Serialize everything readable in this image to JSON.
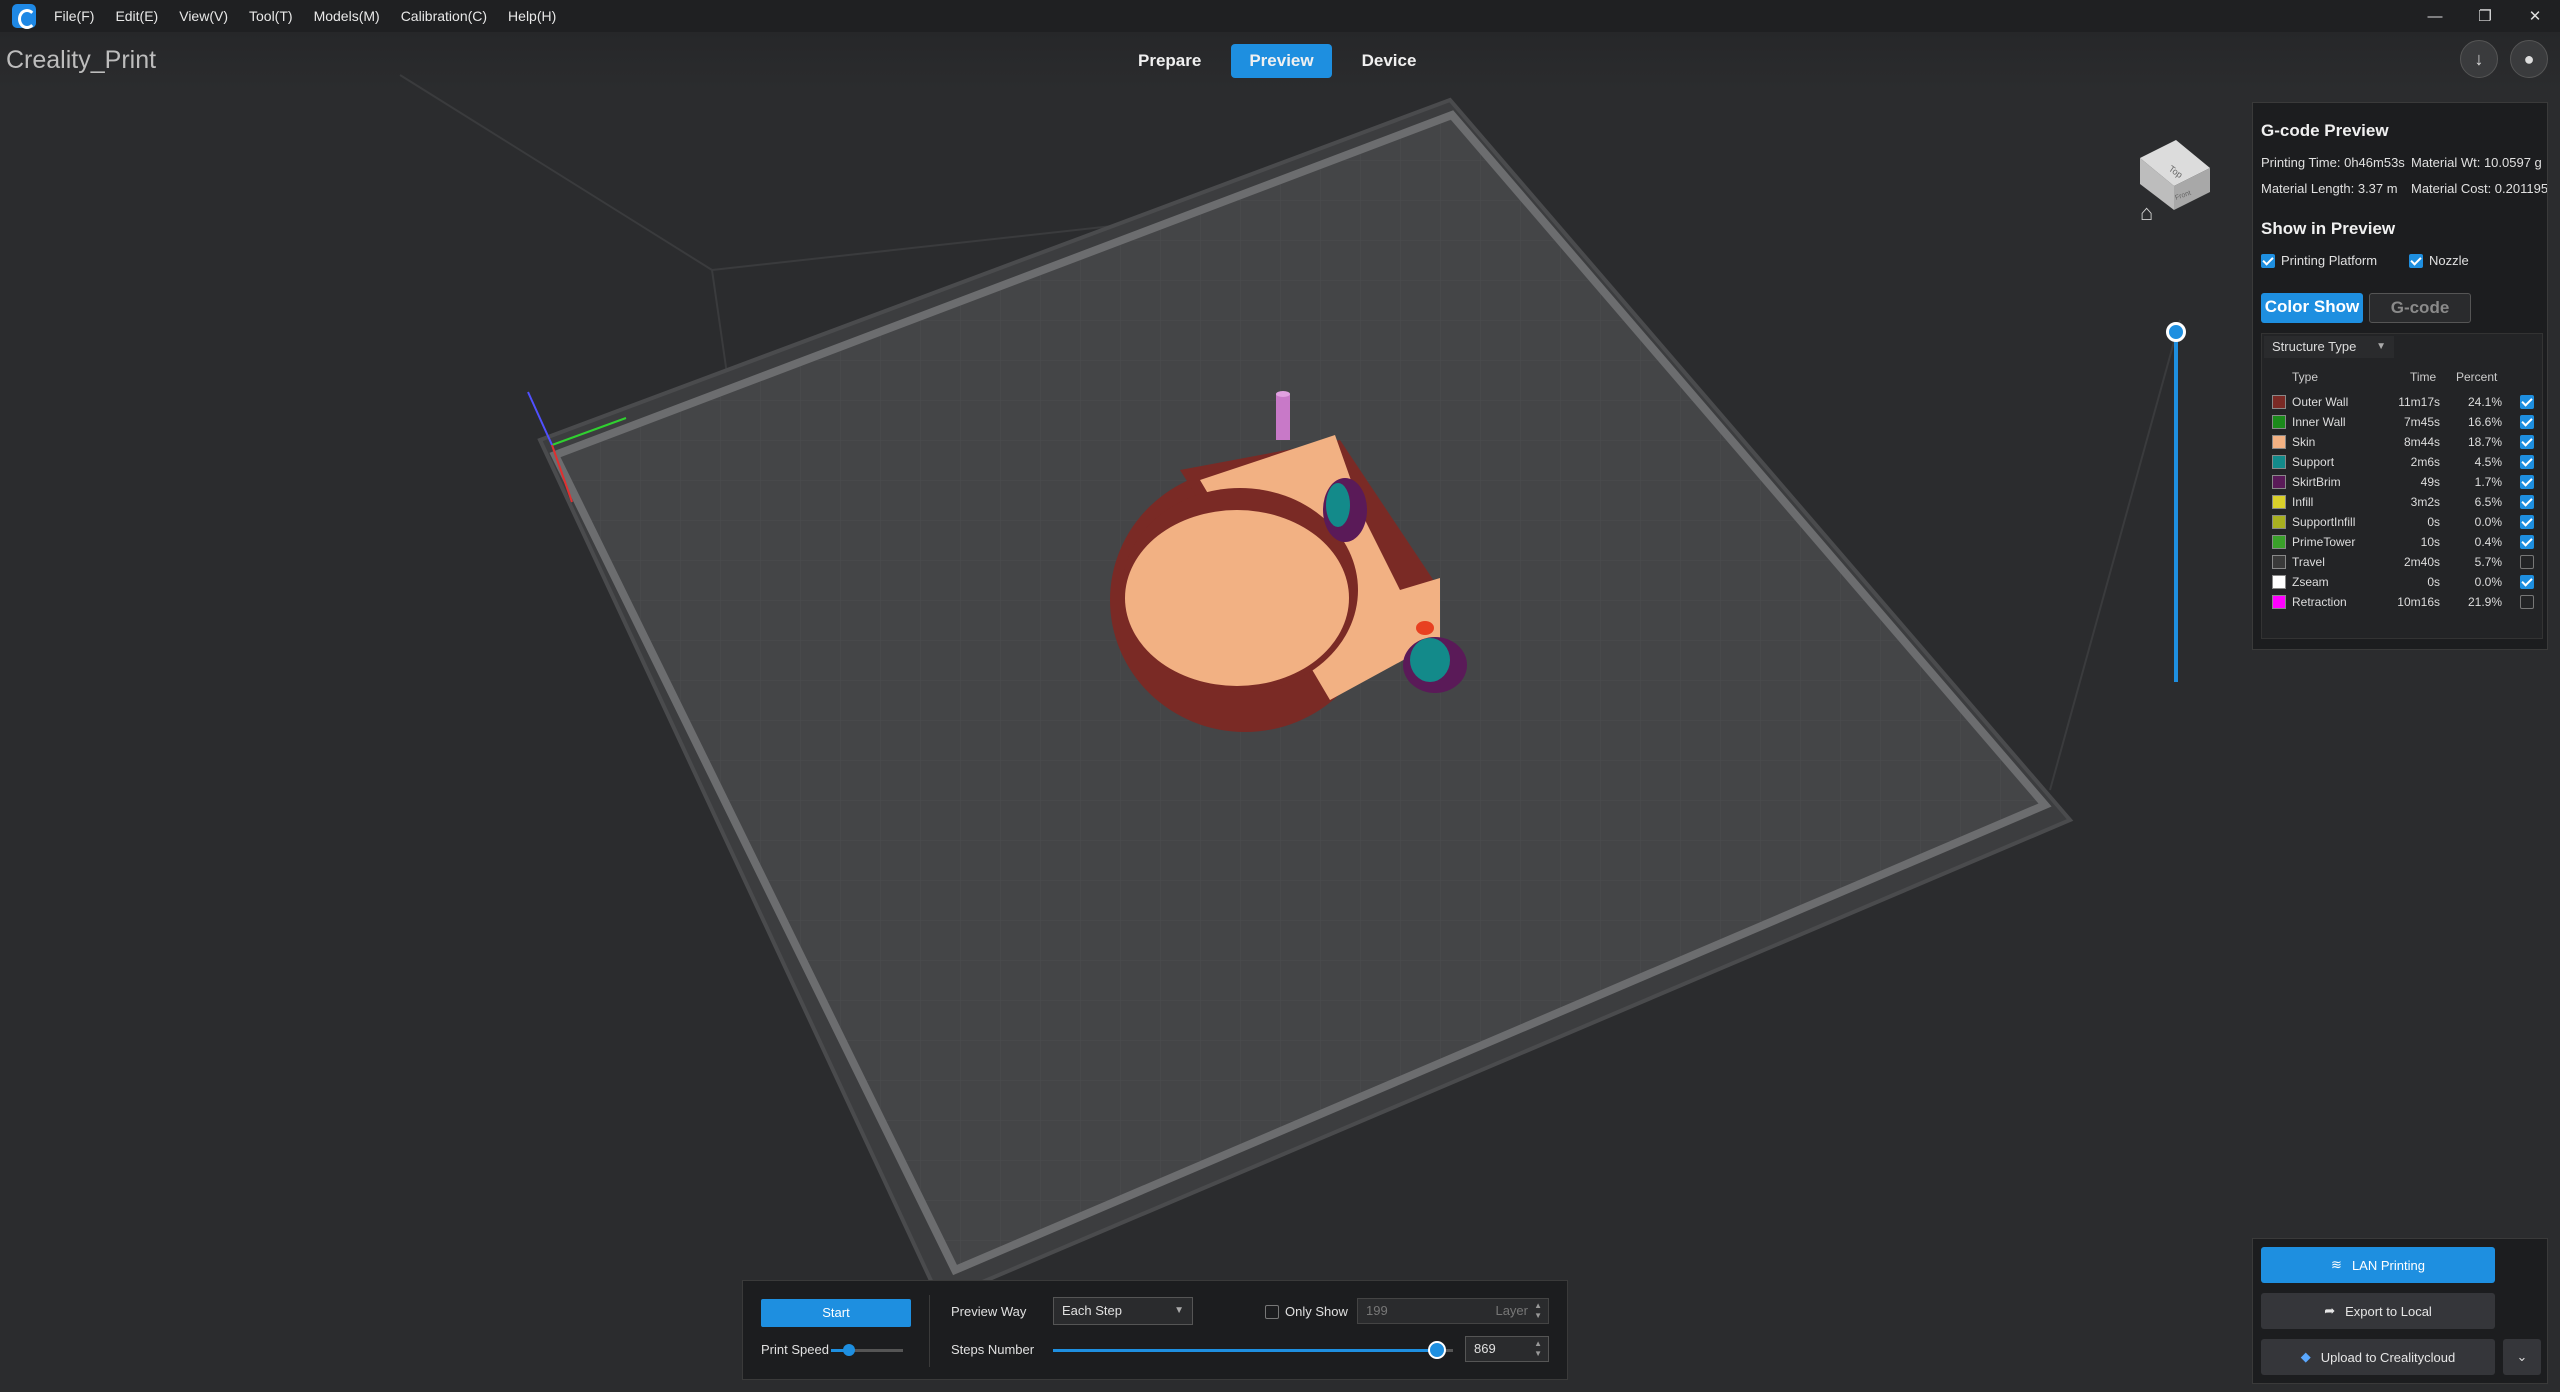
{
  "menu": [
    "File(F)",
    "Edit(E)",
    "View(V)",
    "Tool(T)",
    "Models(M)",
    "Calibration(C)",
    "Help(H)"
  ],
  "window_controls": [
    "—",
    "❐",
    "✕"
  ],
  "project_name": "Creality_Print",
  "tabs": [
    "Prepare",
    "Preview",
    "Device"
  ],
  "active_tab": "Preview",
  "header_icons": [
    "download-icon",
    "user-icon"
  ],
  "gcode_preview": {
    "title": "G-code Preview",
    "printing_time": "Printing Time: 0h46m53s",
    "material_wt": "Material Wt: 10.0597 g",
    "material_length": "Material Length: 3.37 m",
    "material_cost": "Material Cost: 0.201195"
  },
  "show_in_preview": {
    "title": "Show in Preview",
    "printing_platform": "Printing Platform",
    "nozzle": "Nozzle"
  },
  "mode_buttons": {
    "color_show": "Color Show",
    "gcode": "G-code"
  },
  "structure": {
    "select": "Structure Type",
    "headers": {
      "type": "Type",
      "time": "Time",
      "percent": "Percent"
    },
    "rows": [
      {
        "name": "Outer Wall",
        "time": "11m17s",
        "percent": "24.1%",
        "color": "#7a2a25",
        "checked": true
      },
      {
        "name": "Inner Wall",
        "time": "7m45s",
        "percent": "16.6%",
        "color": "#1b8a1b",
        "checked": true
      },
      {
        "name": "Skin",
        "time": "8m44s",
        "percent": "18.7%",
        "color": "#f2b183",
        "checked": true
      },
      {
        "name": "Support",
        "time": "2m6s",
        "percent": "4.5%",
        "color": "#138a8a",
        "checked": true
      },
      {
        "name": "SkirtBrim",
        "time": "49s",
        "percent": "1.7%",
        "color": "#5a1a58",
        "checked": true
      },
      {
        "name": "Infill",
        "time": "3m2s",
        "percent": "6.5%",
        "color": "#d9cf2a",
        "checked": true
      },
      {
        "name": "SupportInfill",
        "time": "0s",
        "percent": "0.0%",
        "color": "#a8b020",
        "checked": true
      },
      {
        "name": "PrimeTower",
        "time": "10s",
        "percent": "0.4%",
        "color": "#3aa02a",
        "checked": true
      },
      {
        "name": "Travel",
        "time": "2m40s",
        "percent": "5.7%",
        "color": "#3a3a3a",
        "checked": false
      },
      {
        "name": "Zseam",
        "time": "0s",
        "percent": "0.0%",
        "color": "#ffffff",
        "checked": true
      },
      {
        "name": "Retraction",
        "time": "10m16s",
        "percent": "21.9%",
        "color": "#ff00ff",
        "checked": false
      }
    ]
  },
  "export": {
    "lan": "LAN Printing",
    "local": "Export to Local",
    "cloud": "Upload to Crealitycloud"
  },
  "bottom": {
    "start": "Start",
    "print_speed": "Print Speed",
    "print_speed_level": 0.25,
    "preview_way_label": "Preview Way",
    "preview_way": "Each Step",
    "only_show": "Only Show",
    "only_show_value": "199",
    "layer": "Layer",
    "steps_label": "Steps Number",
    "steps_value": "869",
    "steps_level": 0.96
  },
  "view_cube": {
    "top": "Top",
    "front": "Front"
  }
}
